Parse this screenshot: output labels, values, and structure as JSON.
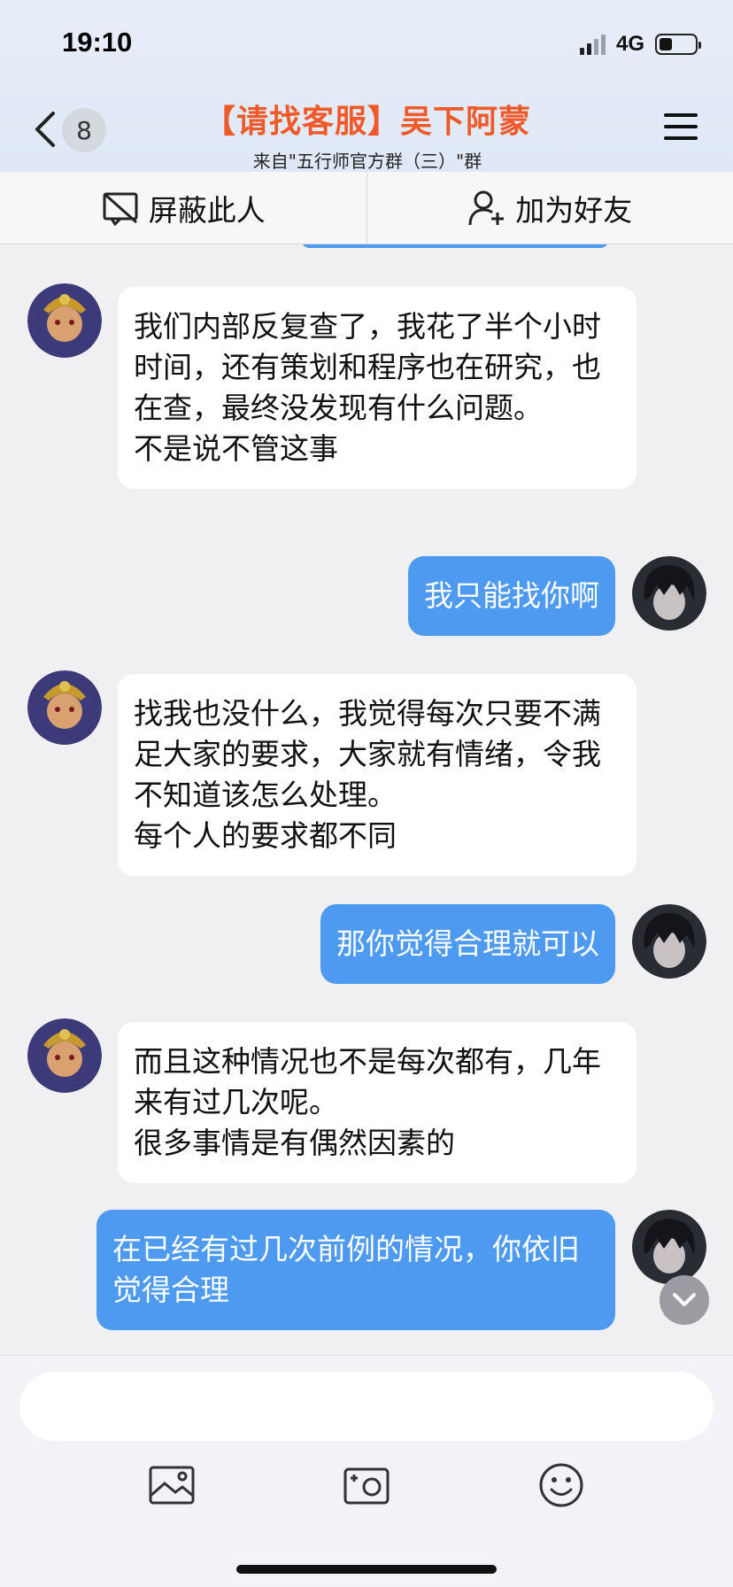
{
  "status_bar": {
    "time": "19:10",
    "network": "4G"
  },
  "header": {
    "back_count": "8",
    "title": "【请找客服】吴下阿蒙",
    "subtitle": "来自\"五行师官方群（三）\"群"
  },
  "actions": {
    "block_label": "屏蔽此人",
    "add_friend_label": "加为好友"
  },
  "messages": [
    {
      "side": "in",
      "text": "我们内部反复查了，我花了半个小时时间，还有策划和程序也在研究，也在查，最终没发现有什么问题。\n不是说不管这事"
    },
    {
      "side": "out",
      "text": "我只能找你啊"
    },
    {
      "side": "in",
      "text": "找我也没什么，我觉得每次只要不满足大家的要求，大家就有情绪，令我不知道该怎么处理。\n每个人的要求都不同"
    },
    {
      "side": "out",
      "text": "那你觉得合理就可以"
    },
    {
      "side": "in",
      "text": "而且这种情况也不是每次都有，几年来有过几次呢。\n很多事情是有偶然因素的"
    },
    {
      "side": "out",
      "text": "在已经有过几次前例的情况，你依旧觉得合理"
    }
  ],
  "input": {
    "placeholder": ""
  },
  "icons": {
    "back": "chevron-left-icon",
    "menu": "menu-icon",
    "block": "block-icon",
    "add_friend": "add-user-icon",
    "scroll_down": "chevron-down-icon",
    "photo": "image-icon",
    "camera": "camera-icon",
    "emoji": "emoji-icon"
  },
  "colors": {
    "accent_title": "#f05a2a",
    "outgoing_bubble": "#4e9af0",
    "incoming_bubble": "#ffffff",
    "background": "#f0f0f2"
  }
}
